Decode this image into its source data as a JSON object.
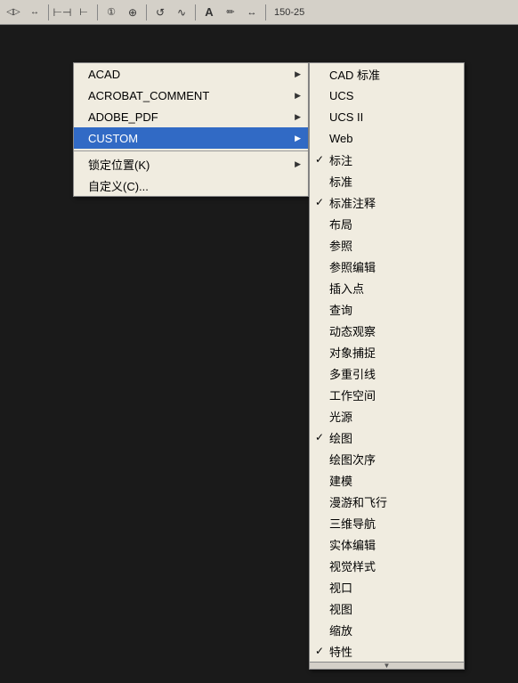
{
  "toolbar": {
    "buttons": [
      {
        "name": "arrow-left",
        "symbol": "◁"
      },
      {
        "name": "double-arrow",
        "symbol": "↔"
      },
      {
        "name": "measure",
        "symbol": "↕"
      },
      {
        "name": "gauge",
        "symbol": "⊢"
      },
      {
        "name": "circle-1",
        "symbol": "①"
      },
      {
        "name": "circle-plus",
        "symbol": "⊕"
      },
      {
        "name": "check-arrow",
        "symbol": "↺"
      },
      {
        "name": "wave",
        "symbol": "∿"
      },
      {
        "name": "text-A",
        "symbol": "A"
      },
      {
        "name": "pencil",
        "symbol": "✏"
      },
      {
        "name": "double-h-arrow",
        "symbol": "↔"
      },
      {
        "name": "counter",
        "symbol": "150-25"
      }
    ]
  },
  "primary_menu": {
    "items": [
      {
        "label": "ACAD",
        "has_submenu": true,
        "id": "acad"
      },
      {
        "label": "ACROBAT_COMMENT",
        "has_submenu": true,
        "id": "acrobat-comment"
      },
      {
        "label": "ADOBE_PDF",
        "has_submenu": true,
        "id": "adobe-pdf"
      },
      {
        "label": "CUSTOM",
        "has_submenu": true,
        "id": "custom",
        "active": true
      },
      {
        "separator": true
      },
      {
        "label": "锁定位置(K)",
        "has_submenu": true,
        "id": "lock-position"
      },
      {
        "label": "自定义(C)...",
        "has_submenu": false,
        "id": "customize"
      }
    ]
  },
  "secondary_menu": {
    "items": [
      {
        "label": "CAD 标准",
        "checked": false,
        "id": "cad-standard"
      },
      {
        "label": "UCS",
        "checked": false,
        "id": "ucs"
      },
      {
        "label": "UCS II",
        "checked": false,
        "id": "ucs-ii"
      },
      {
        "label": "Web",
        "checked": false,
        "id": "web"
      },
      {
        "label": "标注",
        "checked": true,
        "id": "biaozhu"
      },
      {
        "label": "标准",
        "checked": false,
        "id": "biaozhun"
      },
      {
        "label": "标准注释",
        "checked": true,
        "id": "biaozhun-zhushi"
      },
      {
        "label": "布局",
        "checked": false,
        "id": "buju"
      },
      {
        "label": "参照",
        "checked": false,
        "id": "canzhao"
      },
      {
        "label": "参照编辑",
        "checked": false,
        "id": "canzhao-bianji"
      },
      {
        "label": "插入点",
        "checked": false,
        "id": "charudio"
      },
      {
        "label": "查询",
        "checked": false,
        "id": "chaxun"
      },
      {
        "label": "动态观察",
        "checked": false,
        "id": "dongtai-guancha"
      },
      {
        "label": "对象捕捉",
        "checked": false,
        "id": "duixiang-buzuo"
      },
      {
        "label": "多重引线",
        "checked": false,
        "id": "duochong-yinxian"
      },
      {
        "label": "工作空间",
        "checked": false,
        "id": "gongzuo-kongjian"
      },
      {
        "label": "光源",
        "checked": false,
        "id": "guangyuan"
      },
      {
        "label": "绘图",
        "checked": true,
        "id": "huitu"
      },
      {
        "label": "绘图次序",
        "checked": false,
        "id": "huitu-cixu"
      },
      {
        "label": "建模",
        "checked": false,
        "id": "jianmo"
      },
      {
        "label": "漫游和飞行",
        "checked": false,
        "id": "manyou-feixing"
      },
      {
        "label": "三维导航",
        "checked": false,
        "id": "sanwei-daohang"
      },
      {
        "label": "实体编辑",
        "checked": false,
        "id": "shiti-bianji"
      },
      {
        "label": "视觉样式",
        "checked": false,
        "id": "shijue-yangshi"
      },
      {
        "label": "视口",
        "checked": false,
        "id": "shikou"
      },
      {
        "label": "视图",
        "checked": false,
        "id": "shitu"
      },
      {
        "label": "缩放",
        "checked": false,
        "id": "suofang"
      },
      {
        "label": "特性",
        "checked": true,
        "id": "texing"
      }
    ]
  }
}
